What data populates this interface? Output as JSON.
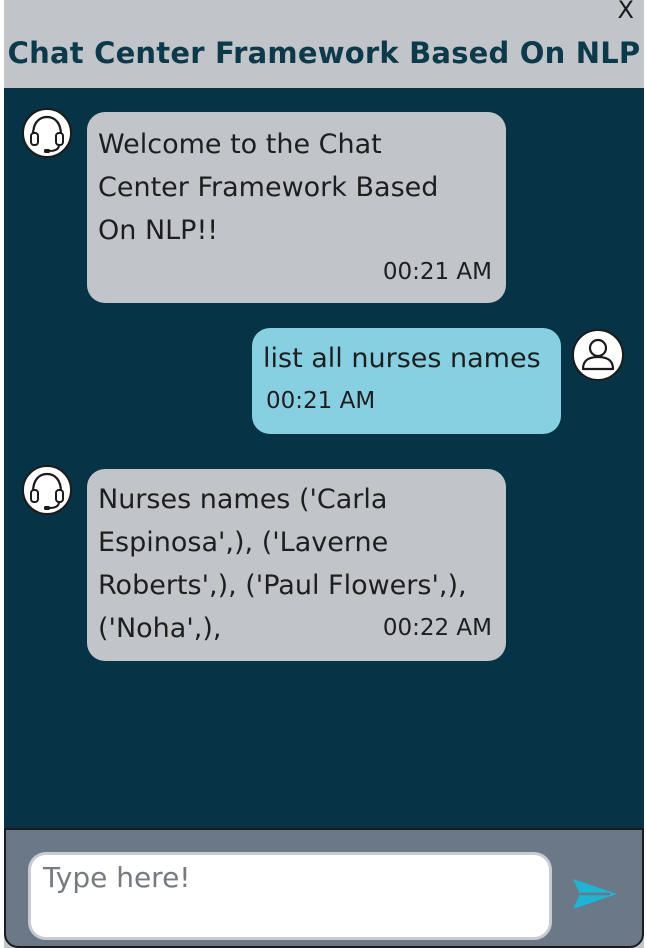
{
  "header": {
    "title": "Chat Center Framework Based On NLP",
    "close_label": "X"
  },
  "messages": [
    {
      "sender": "bot",
      "text": "Welcome to the Chat\nCenter Framework Based\nOn NLP!!",
      "time": "00:21 AM",
      "avatar_icon": "headset-icon"
    },
    {
      "sender": "user",
      "text": "list all nurses names",
      "time": "00:21 AM",
      "avatar_icon": "user-icon"
    },
    {
      "sender": "bot",
      "text": "Nurses names ('Carla\nEspinosa',), ('Laverne\nRoberts',), ('Paul Flowers',),\n('Noha',),",
      "time": "00:22 AM",
      "avatar_icon": "headset-icon"
    }
  ],
  "composer": {
    "placeholder": "Type here!",
    "value": "",
    "send_icon": "send-icon"
  },
  "colors": {
    "header_bg": "#c1c5ca",
    "title": "#0b3a4a",
    "chat_bg": "#063346",
    "bot_bubble": "#c1c5ca",
    "user_bubble": "#86d0e2",
    "composer_bg": "#6b7888",
    "send_accent": "#1bb6d4"
  }
}
